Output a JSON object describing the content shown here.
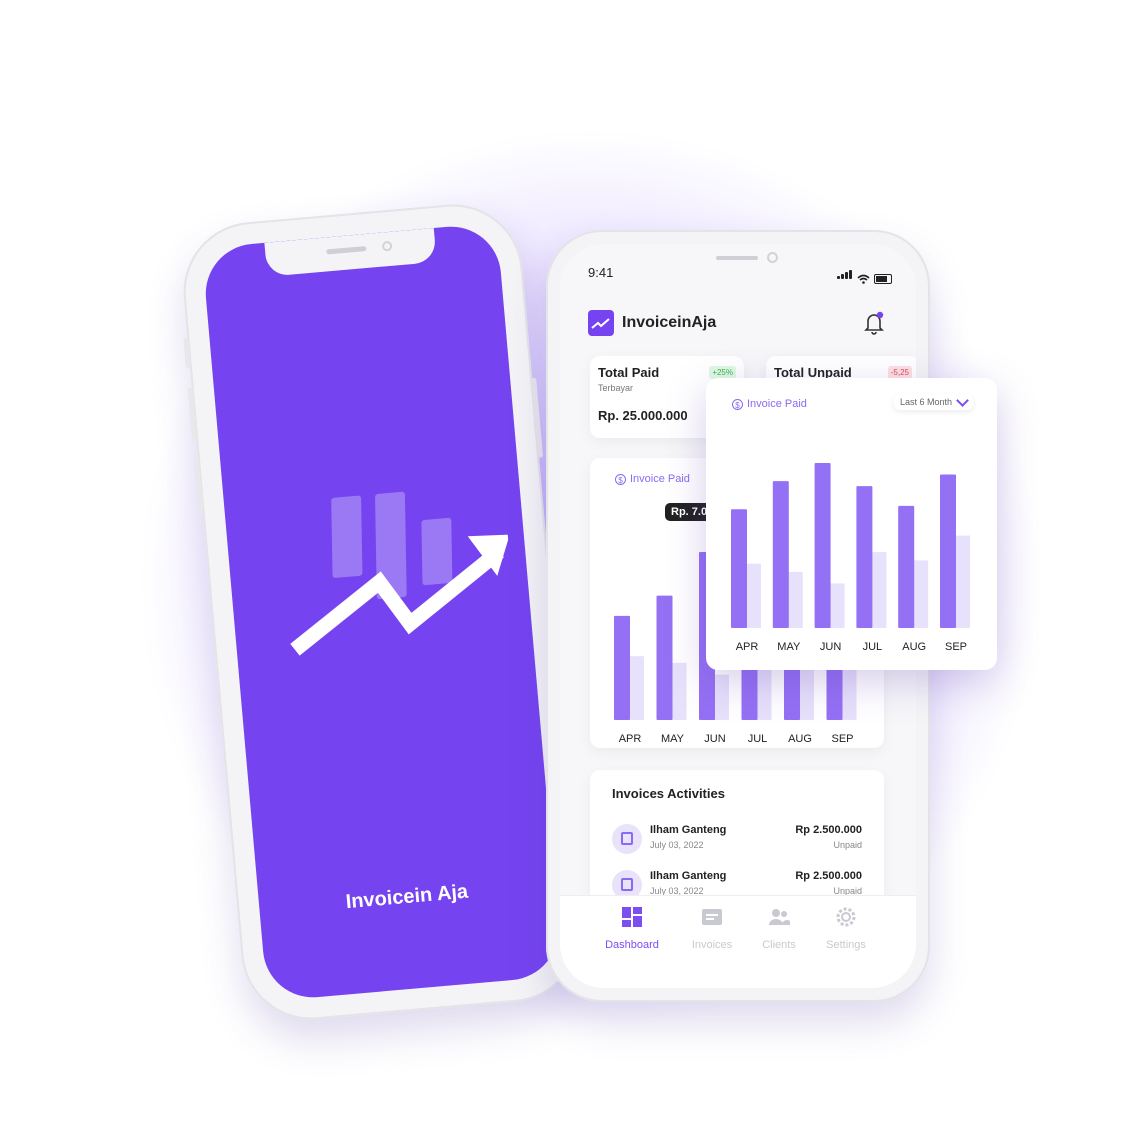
{
  "splash": {
    "brand": "Invoicein Aja"
  },
  "status_bar": {
    "time": "9:41"
  },
  "app": {
    "title": "InvoiceinAja"
  },
  "summary": {
    "paid": {
      "title": "Total Paid",
      "subtitle": "Terbayar",
      "amount": "Rp. 25.000.000",
      "change": "+25%"
    },
    "unpaid": {
      "title": "Total Unpaid",
      "change": "-5,25"
    }
  },
  "chart_card": {
    "label": "Invoice Paid",
    "tooltip": "Rp. 7.0"
  },
  "popup": {
    "label": "Invoice Paid",
    "period": "Last 6 Month"
  },
  "chart_data": {
    "type": "bar",
    "categories": [
      "APR",
      "MAY",
      "JUN",
      "JUL",
      "AUG",
      "SEP"
    ],
    "series": [
      {
        "values": [
          62,
          74,
          100,
          86,
          74,
          95
        ]
      },
      {
        "values": [
          38,
          34,
          27,
          48,
          42,
          56
        ]
      }
    ],
    "popup_series": [
      {
        "values": [
          72,
          89,
          100,
          86,
          74,
          93
        ]
      },
      {
        "values": [
          39,
          34,
          27,
          46,
          41,
          56
        ]
      }
    ],
    "colors": {
      "primary": "#9470f4",
      "secondary": "#e7e1fb"
    }
  },
  "activities": {
    "title": "Invoices Activities",
    "items": [
      {
        "name": "Ilham Ganteng",
        "date": "July 03, 2022",
        "amount": "Rp 2.500.000",
        "status": "Unpaid"
      },
      {
        "name": "Ilham Ganteng",
        "date": "July 03, 2022",
        "amount": "Rp 2.500.000",
        "status": "Unpaid"
      }
    ]
  },
  "nav": {
    "items": [
      {
        "label": "Dashboard",
        "icon": "dashboard-icon",
        "active": true
      },
      {
        "label": "Invoices",
        "icon": "invoice-icon",
        "active": false
      },
      {
        "label": "Clients",
        "icon": "clients-icon",
        "active": false
      },
      {
        "label": "Settings",
        "icon": "gear-icon",
        "active": false
      }
    ]
  },
  "colors": {
    "brand": "#7544f0",
    "accent": "#9470f4"
  }
}
